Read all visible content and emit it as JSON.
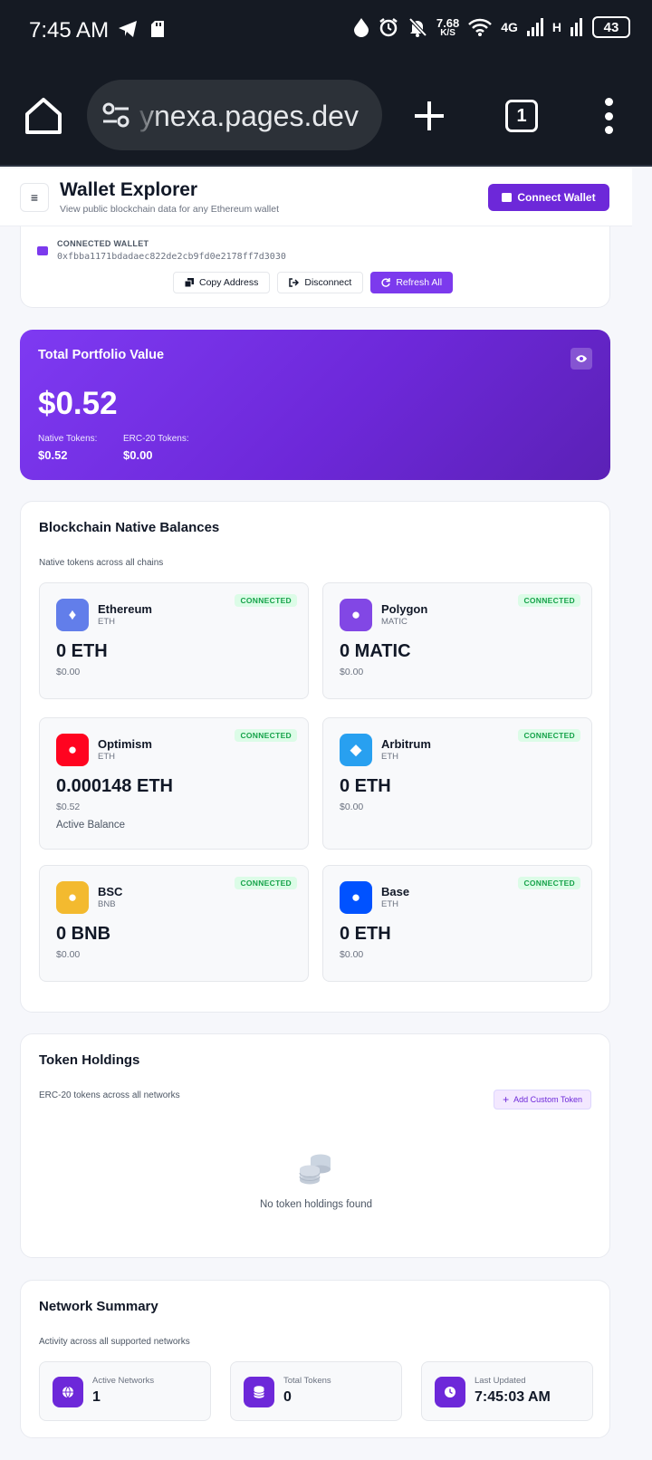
{
  "status_bar": {
    "time": "7:45 AM",
    "speed_value": "7.68",
    "speed_unit": "K/S",
    "network": "4G",
    "network2": "H",
    "battery": "43",
    "icons": [
      "telegram-icon",
      "sd-card-icon",
      "water-drop-icon",
      "alarm-icon",
      "bell-off-icon",
      "wifi-icon",
      "signal-icon"
    ]
  },
  "browser": {
    "url": "ynexa.pages.dev",
    "tab_count": "1"
  },
  "header": {
    "menu_glyph": "≡",
    "title": "Wallet Explorer",
    "subtitle": "View public blockchain data for any Ethereum wallet",
    "connect_label": "Connect Wallet"
  },
  "wallet": {
    "label": "CONNECTED WALLET",
    "address": "0xfbba1171bdadaec822de2cb9fd0e2178ff7d3030",
    "copy_label": "Copy Address",
    "disconnect_label": "Disconnect",
    "refresh_label": "Refresh All"
  },
  "portfolio": {
    "title": "Total Portfolio Value",
    "value": "$0.52",
    "native_label": "Native Tokens:",
    "native_value": "$0.52",
    "erc20_label": "ERC-20 Tokens:",
    "erc20_value": "$0.00"
  },
  "balances": {
    "title": "Blockchain Native Balances",
    "subtitle": "Native tokens across all chains",
    "chains": [
      {
        "name": "Ethereum",
        "symbol": "ETH",
        "amount": "0 ETH",
        "usd": "$0.00",
        "status": "CONNECTED",
        "icon": "♦",
        "color": "#627eea",
        "note": ""
      },
      {
        "name": "Polygon",
        "symbol": "MATIC",
        "amount": "0 MATIC",
        "usd": "$0.00",
        "status": "CONNECTED",
        "icon": "●",
        "color": "#8247e5",
        "note": ""
      },
      {
        "name": "Optimism",
        "symbol": "ETH",
        "amount": "0.000148 ETH",
        "usd": "$0.52",
        "status": "CONNECTED",
        "icon": "●",
        "color": "#ff0420",
        "note": "Active Balance"
      },
      {
        "name": "Arbitrum",
        "symbol": "ETH",
        "amount": "0 ETH",
        "usd": "$0.00",
        "status": "CONNECTED",
        "icon": "◆",
        "color": "#28a0f0",
        "note": ""
      },
      {
        "name": "BSC",
        "symbol": "BNB",
        "amount": "0 BNB",
        "usd": "$0.00",
        "status": "CONNECTED",
        "icon": "●",
        "color": "#f3ba2f",
        "note": ""
      },
      {
        "name": "Base",
        "symbol": "ETH",
        "amount": "0 ETH",
        "usd": "$0.00",
        "status": "CONNECTED",
        "icon": "●",
        "color": "#0052ff",
        "note": ""
      }
    ]
  },
  "tokens": {
    "title": "Token Holdings",
    "subtitle": "ERC-20 tokens across all networks",
    "add_label": "Add Custom Token",
    "empty_text": "No token holdings found"
  },
  "summary": {
    "title": "Network Summary",
    "subtitle": "Activity across all supported networks",
    "stats": [
      {
        "label": "Active Networks",
        "value": "1",
        "icon": "globe-icon"
      },
      {
        "label": "Total Tokens",
        "value": "0",
        "icon": "database-icon"
      },
      {
        "label": "Last Updated",
        "value": "7:45:03 AM",
        "icon": "clock-icon"
      }
    ]
  },
  "colors": {
    "accent": "#6d28d9",
    "accent_light": "#7c3aed",
    "success": "#16a34a"
  }
}
